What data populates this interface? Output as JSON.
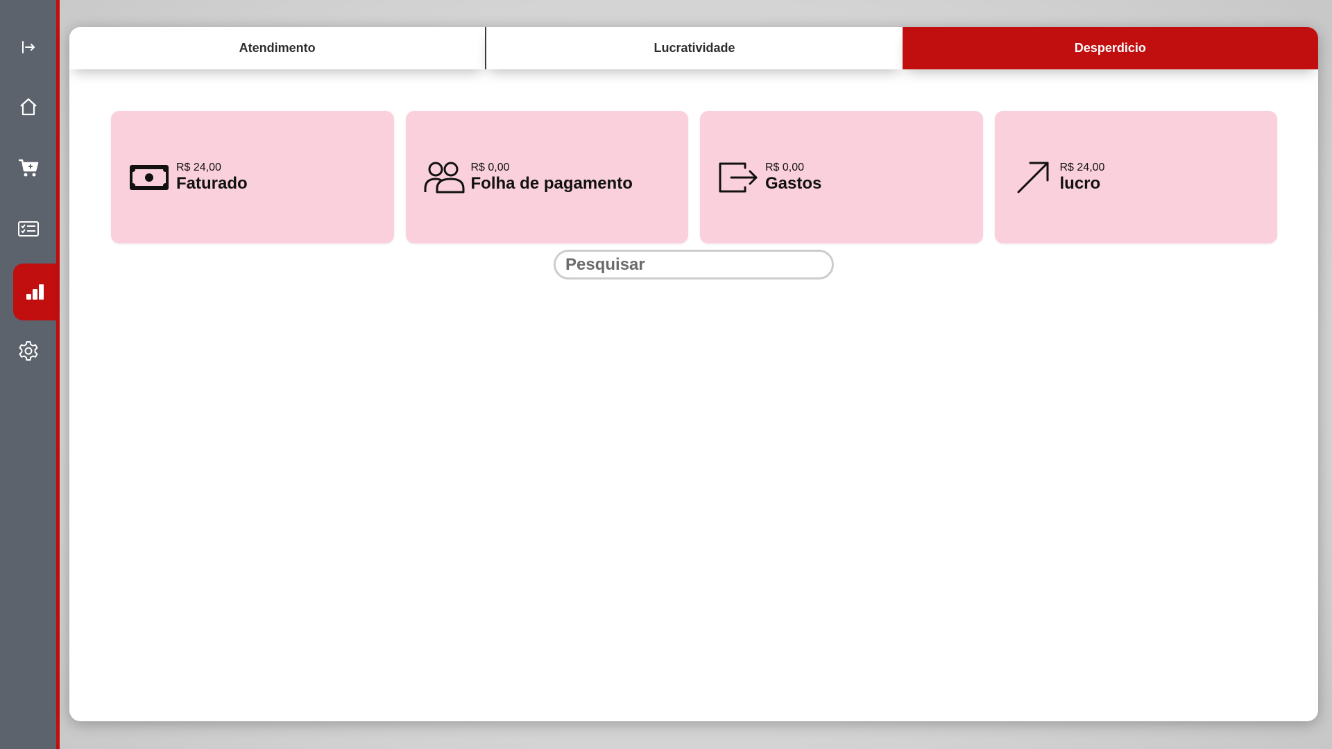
{
  "sidebar": {
    "items": [
      {
        "icon": "collapse-arrow-icon"
      },
      {
        "icon": "home-icon"
      },
      {
        "icon": "cart-icon"
      },
      {
        "icon": "checklist-icon"
      },
      {
        "icon": "bar-chart-icon",
        "active": true
      },
      {
        "icon": "gear-icon"
      }
    ],
    "accent": "#c10e0e",
    "background": "#5d636c"
  },
  "tabs": [
    {
      "label": "Atendimento",
      "active": false
    },
    {
      "label": "Lucratividade",
      "active": false
    },
    {
      "label": "Desperdicio",
      "active": true
    }
  ],
  "cards": [
    {
      "icon": "money-icon",
      "amount": "R$ 24,00",
      "label": "Faturado"
    },
    {
      "icon": "people-icon",
      "amount": "R$ 0,00",
      "label": "Folha de pagamento"
    },
    {
      "icon": "exit-icon",
      "amount": "R$ 0,00",
      "label": "Gastos"
    },
    {
      "icon": "arrow-up-right-icon",
      "amount": "R$ 24,00",
      "label": "lucro"
    }
  ],
  "search": {
    "placeholder": "Pesquisar",
    "value": ""
  },
  "colors": {
    "card_background": "#f9d0dc",
    "active_tab": "#c10e0e"
  }
}
